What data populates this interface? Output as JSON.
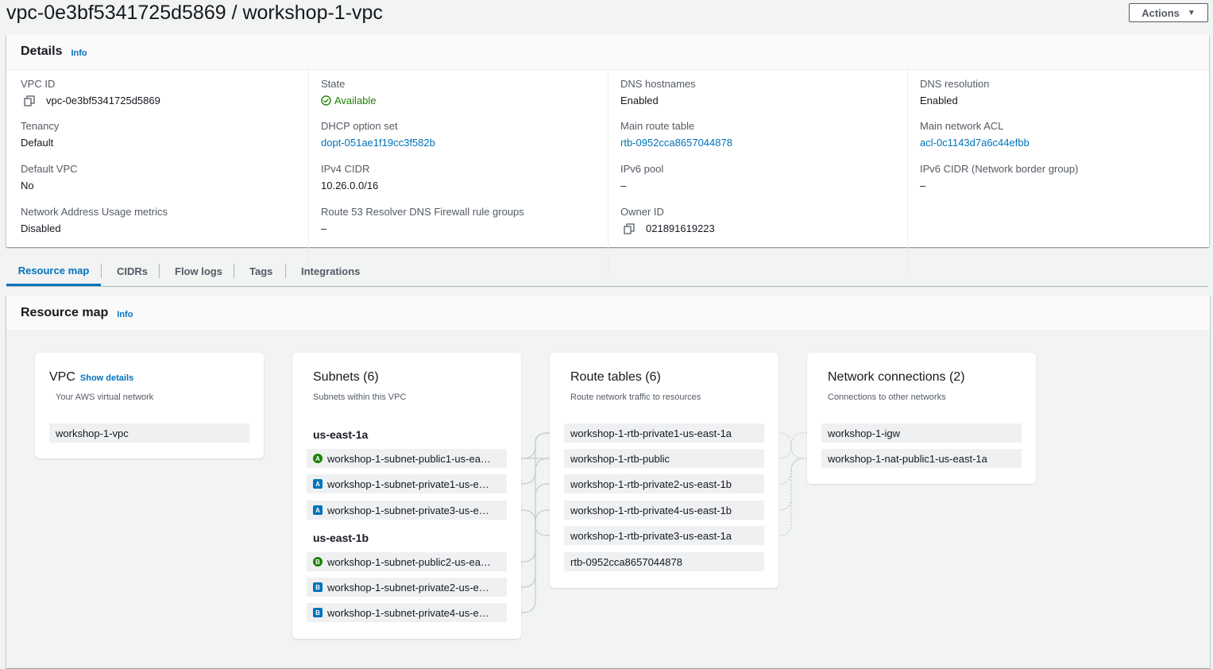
{
  "header": {
    "title": "vpc-0e3bf5341725d5869 / workshop-1-vpc",
    "actions_label": "Actions"
  },
  "details": {
    "title": "Details",
    "info": "Info",
    "vpc_id": {
      "label": "VPC ID",
      "value": "vpc-0e3bf5341725d5869"
    },
    "tenancy": {
      "label": "Tenancy",
      "value": "Default"
    },
    "default_vpc": {
      "label": "Default VPC",
      "value": "No"
    },
    "nau_metrics": {
      "label": "Network Address Usage metrics",
      "value": "Disabled"
    },
    "state": {
      "label": "State",
      "value": "Available"
    },
    "dhcp": {
      "label": "DHCP option set",
      "value": "dopt-051ae1f19cc3f582b"
    },
    "ipv4_cidr": {
      "label": "IPv4 CIDR",
      "value": "10.26.0.0/16"
    },
    "r53_firewall": {
      "label": "Route 53 Resolver DNS Firewall rule groups",
      "value": "–"
    },
    "dns_hostnames": {
      "label": "DNS hostnames",
      "value": "Enabled"
    },
    "main_route_table": {
      "label": "Main route table",
      "value": "rtb-0952cca8657044878"
    },
    "ipv6_pool": {
      "label": "IPv6 pool",
      "value": "–"
    },
    "owner_id": {
      "label": "Owner ID",
      "value": "021891619223"
    },
    "dns_resolution": {
      "label": "DNS resolution",
      "value": "Enabled"
    },
    "main_acl": {
      "label": "Main network ACL",
      "value": "acl-0c1143d7a6c44efbb"
    },
    "ipv6_cidr": {
      "label": "IPv6 CIDR (Network border group)",
      "value": "–"
    }
  },
  "tabs": [
    "Resource map",
    "CIDRs",
    "Flow logs",
    "Tags",
    "Integrations"
  ],
  "resource_map": {
    "title": "Resource map",
    "info": "Info",
    "vpc_card": {
      "title": "VPC",
      "link": "Show details",
      "subtitle": "Your AWS virtual network",
      "node": "workshop-1-vpc"
    },
    "subnets_card": {
      "title": "Subnets (6)",
      "subtitle": "Subnets within this VPC",
      "az_a": "us-east-1a",
      "az_b": "us-east-1b",
      "items": [
        {
          "badge": "A",
          "label": "workshop-1-subnet-public1-us-ea…"
        },
        {
          "badge": "A",
          "label": "workshop-1-subnet-private1-us-e…"
        },
        {
          "badge": "A",
          "label": "workshop-1-subnet-private3-us-e…"
        },
        {
          "badge": "B",
          "label": "workshop-1-subnet-public2-us-ea…"
        },
        {
          "badge": "B",
          "label": "workshop-1-subnet-private2-us-e…"
        },
        {
          "badge": "B",
          "label": "workshop-1-subnet-private4-us-e…"
        }
      ]
    },
    "route_tables_card": {
      "title": "Route tables (6)",
      "subtitle": "Route network traffic to resources",
      "items": [
        "workshop-1-rtb-private1-us-east-1a",
        "workshop-1-rtb-public",
        "workshop-1-rtb-private2-us-east-1b",
        "workshop-1-rtb-private4-us-east-1b",
        "workshop-1-rtb-private3-us-east-1a",
        "rtb-0952cca8657044878"
      ]
    },
    "network_card": {
      "title": "Network connections (2)",
      "subtitle": "Connections to other networks",
      "items": [
        "workshop-1-igw",
        "workshop-1-nat-public1-us-east-1a"
      ]
    }
  },
  "colors": {
    "link": "#0073bb",
    "public_badge": "#1d8102",
    "private_badge": "#0073bb",
    "ok": "#1d8102"
  }
}
